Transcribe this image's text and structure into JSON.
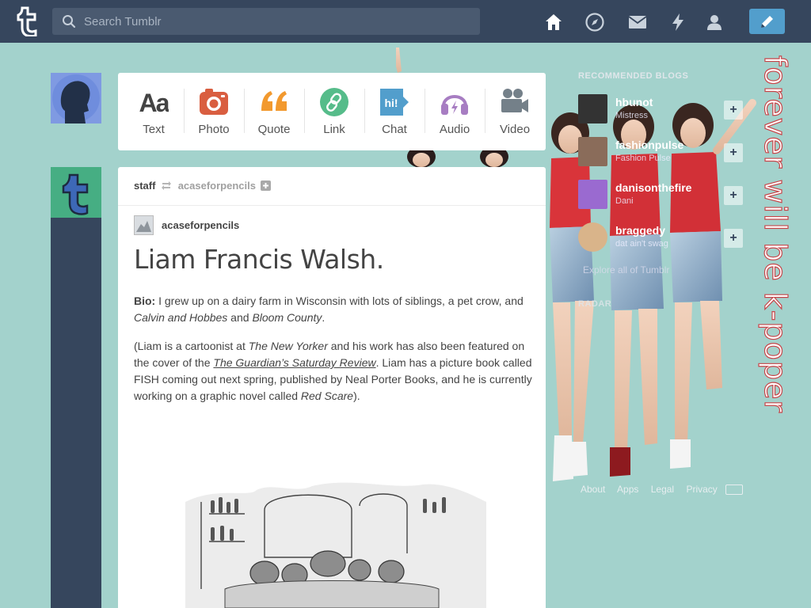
{
  "header": {
    "search_placeholder": "Search Tumblr",
    "nav": [
      "home-icon",
      "explore-icon",
      "messages-icon",
      "activity-icon",
      "account-icon"
    ],
    "compose_icon": "pencil-icon"
  },
  "post_types": [
    {
      "label": "Text",
      "icon": "text-icon",
      "color": "#444444"
    },
    {
      "label": "Photo",
      "icon": "camera-icon",
      "color": "#d95e40"
    },
    {
      "label": "Quote",
      "icon": "quote-icon",
      "color": "#f2992e"
    },
    {
      "label": "Link",
      "icon": "link-icon",
      "color": "#56bc8a"
    },
    {
      "label": "Chat",
      "icon": "chat-icon",
      "color": "#529ecc"
    },
    {
      "label": "Audio",
      "icon": "audio-icon",
      "color": "#a77dc2"
    },
    {
      "label": "Video",
      "icon": "video-icon",
      "color": "#748089"
    }
  ],
  "post": {
    "reblogger": "staff",
    "source_blog": "acaseforpencils",
    "author": "acaseforpencils",
    "title": "Liam Francis Walsh.",
    "bio_label": "Bio:",
    "bio_text_1": " I grew up on a dairy farm in Wisconsin with lots of siblings, a pet crow, and ",
    "bio_italic_1": "Calvin and Hobbes",
    "bio_text_2": " and ",
    "bio_italic_2": "Bloom County",
    "bio_text_3": ".",
    "p2_text_1": "(Liam is a cartoonist at ",
    "p2_italic_1": "The New Yorker",
    "p2_text_2": " and his work has also been featured on the cover of the ",
    "p2_link": "The Guardian’s Saturday Review",
    "p2_text_3": ". Liam has a picture book called FISH coming out next spring, published by Neal Porter Books, and he is currently working on a graphic novel called ",
    "p2_italic_2": "Red Scare",
    "p2_text_4": ")."
  },
  "recommended": {
    "title": "RECOMMENDED BLOGS",
    "blogs": [
      {
        "name": "hbunot",
        "sub": "Mistress",
        "color": "#333333"
      },
      {
        "name": "fashionpulse",
        "sub": "Fashion Pulse",
        "color": "#8a6c5a"
      },
      {
        "name": "danisonthefire",
        "sub": "Dani",
        "color": "#9a6ad0"
      },
      {
        "name": "braggedy",
        "sub": "dat ain't swag",
        "color": "#d9b48a"
      }
    ],
    "explore": "Explore all of Tumblr",
    "radar": "RADAR"
  },
  "footer": [
    "About",
    "Apps",
    "Legal",
    "Privacy"
  ],
  "vertical_text": "forever will be k-poper",
  "colors": {
    "background": "#a3d2cc",
    "header": "#36465d",
    "compose": "#529ecc"
  }
}
